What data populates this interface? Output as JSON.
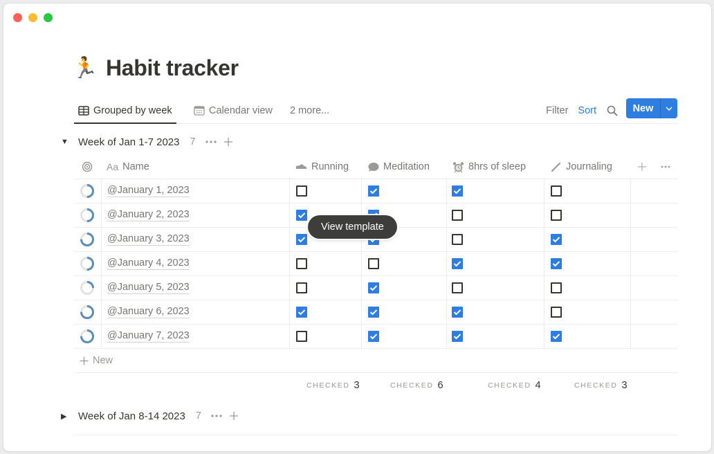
{
  "window": {
    "traffic_lights": [
      "close",
      "minimize",
      "zoom"
    ]
  },
  "page": {
    "icon": "🏃",
    "title": "Habit tracker"
  },
  "views": {
    "tabs": [
      {
        "label": "Grouped by week",
        "icon": "table-icon",
        "active": true
      },
      {
        "label": "Calendar view",
        "icon": "calendar-icon",
        "active": false
      },
      {
        "label": "2 more...",
        "icon": null,
        "active": false
      }
    ],
    "toolbar": {
      "filter_label": "Filter",
      "sort_label": "Sort",
      "search_icon": "search-icon",
      "more_icon": "more-icon",
      "new_label": "New",
      "new_caret_icon": "chevron-down-icon"
    },
    "accent_color": "#2e7de0"
  },
  "groups": [
    {
      "title": "Week of Jan 1-7 2023",
      "count": "7",
      "expanded": true
    },
    {
      "title": "Week of Jan 8-14 2023",
      "count": "7",
      "expanded": false
    }
  ],
  "table": {
    "columns": [
      {
        "key": "progress",
        "label": "",
        "icon": "progress-ring-icon"
      },
      {
        "key": "name",
        "label": "Name",
        "icon": "Aa"
      },
      {
        "key": "running",
        "label": "Running",
        "icon": "shoe-icon"
      },
      {
        "key": "meditation",
        "label": "Meditation",
        "icon": "speech-bubble-icon"
      },
      {
        "key": "sleep",
        "label": "8hrs of sleep",
        "icon": "alarm-clock-icon"
      },
      {
        "key": "journaling",
        "label": "Journaling",
        "icon": "pencil-icon"
      }
    ],
    "rows": [
      {
        "name": "@January 1, 2023",
        "progress": 0.5,
        "running": false,
        "meditation": true,
        "sleep": true,
        "journaling": false
      },
      {
        "name": "@January 2, 2023",
        "progress": 0.5,
        "running": true,
        "meditation": true,
        "sleep": false,
        "journaling": false
      },
      {
        "name": "@January 3, 2023",
        "progress": 0.75,
        "running": true,
        "meditation": true,
        "sleep": false,
        "journaling": true
      },
      {
        "name": "@January 4, 2023",
        "progress": 0.5,
        "running": false,
        "meditation": false,
        "sleep": true,
        "journaling": true
      },
      {
        "name": "@January 5, 2023",
        "progress": 0.25,
        "running": false,
        "meditation": true,
        "sleep": false,
        "journaling": false
      },
      {
        "name": "@January 6, 2023",
        "progress": 0.75,
        "running": true,
        "meditation": true,
        "sleep": true,
        "journaling": false
      },
      {
        "name": "@January 7, 2023",
        "progress": 0.75,
        "running": false,
        "meditation": true,
        "sleep": true,
        "journaling": true
      }
    ],
    "new_row_label": "New",
    "calculations": [
      {
        "label": "CHECKED",
        "value": "3"
      },
      {
        "label": "CHECKED",
        "value": "6"
      },
      {
        "label": "CHECKED",
        "value": "4"
      },
      {
        "label": "CHECKED",
        "value": "3"
      }
    ]
  },
  "tooltip": {
    "text": "View template"
  }
}
